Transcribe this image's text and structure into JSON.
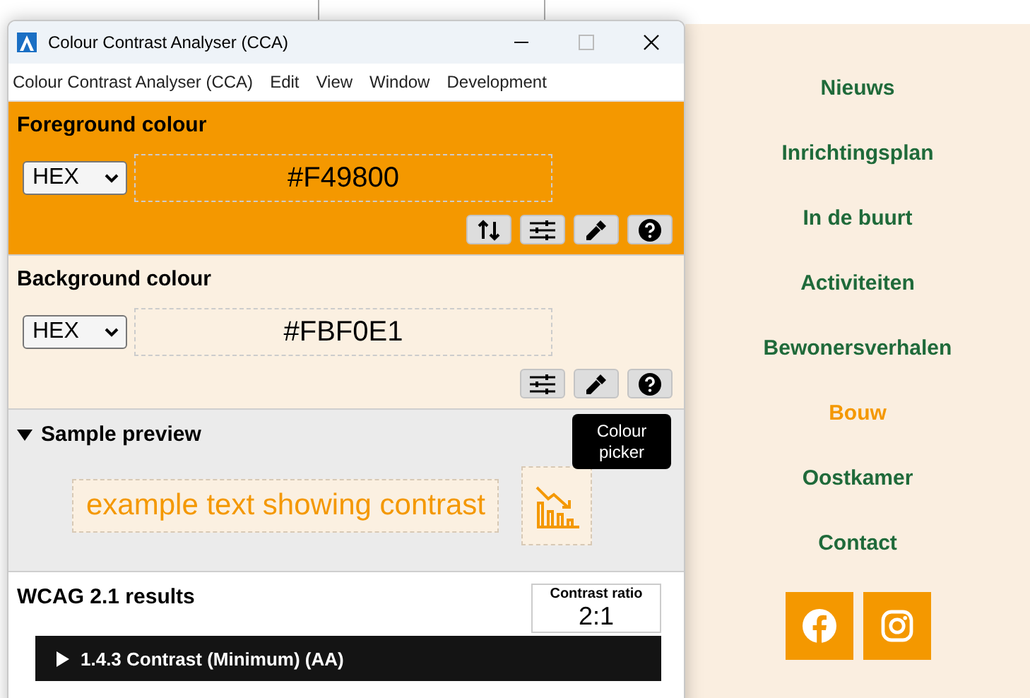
{
  "window": {
    "title": "Colour Contrast Analyser (CCA)"
  },
  "menu": [
    "Colour Contrast Analyser (CCA)",
    "Edit",
    "View",
    "Window",
    "Development"
  ],
  "colours": [
    {
      "heading": "Foreground colour",
      "format": "HEX",
      "value": "#F49800",
      "color": "#f49800",
      "tools": [
        {
          "kind": "swap"
        },
        {
          "kind": "sliders"
        },
        {
          "kind": "eyedropper"
        },
        {
          "kind": "help"
        }
      ]
    },
    {
      "heading": "Background colour",
      "format": "HEX",
      "value": "#FBF0E1",
      "color": "#fbf0e1",
      "tools": [
        {
          "kind": "sliders"
        },
        {
          "kind": "eyedropper"
        },
        {
          "kind": "help"
        }
      ]
    }
  ],
  "tooltip": "Colour picker",
  "sample": {
    "heading": "Sample preview",
    "expanded": true,
    "text": "example text showing contrast"
  },
  "results": {
    "heading": "WCAG 2.1 results",
    "ratio_label": "Contrast ratio",
    "ratio": "2:1",
    "criteria": [
      {
        "label": "1.4.3 Contrast (Minimum) (AA)",
        "expanded": false
      }
    ]
  },
  "website": {
    "nav": [
      {
        "label": "Nieuws",
        "selected": false
      },
      {
        "label": "Inrichtingsplan",
        "selected": false
      },
      {
        "label": "In de buurt",
        "selected": false
      },
      {
        "label": "Activiteiten",
        "selected": false
      },
      {
        "label": "Bewonersverhalen",
        "selected": false
      },
      {
        "label": "Bouw",
        "selected": true
      },
      {
        "label": "Oostkamer",
        "selected": false
      },
      {
        "label": "Contact",
        "selected": false
      }
    ],
    "social": [
      {
        "kind": "facebook"
      },
      {
        "kind": "instagram"
      }
    ]
  }
}
